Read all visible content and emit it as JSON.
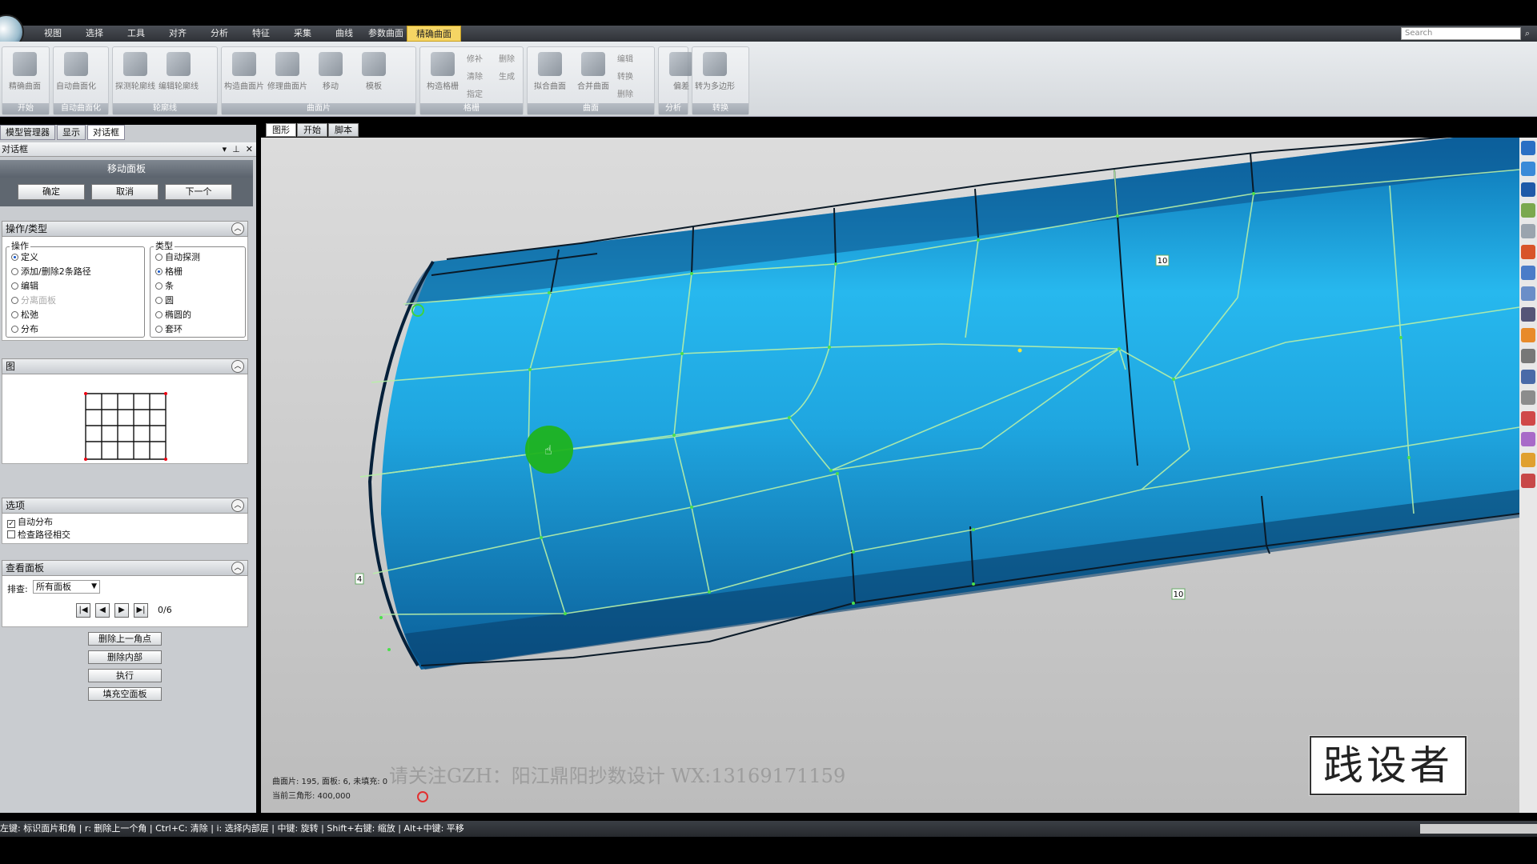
{
  "menu": {
    "items": [
      "视图",
      "选择",
      "工具",
      "对齐",
      "分析",
      "特征",
      "采集",
      "曲线",
      "参数曲面",
      "精确曲面"
    ],
    "active_index": 9,
    "search_placeholder": "Search"
  },
  "ribbon": {
    "groups": [
      {
        "title": "开始",
        "buttons": [
          "精确曲面"
        ]
      },
      {
        "title": "自动曲面化",
        "buttons": [
          "自动曲面化"
        ]
      },
      {
        "title": "轮廓线",
        "buttons": [
          "探测轮廓线",
          "编辑轮廓线"
        ]
      },
      {
        "title": "曲面片",
        "buttons": [
          "构造曲面片",
          "修理曲面片",
          "移动",
          "模板"
        ]
      },
      {
        "title": "格栅",
        "buttons": [
          "构造格栅"
        ],
        "small": [
          "修补",
          "清除",
          "指定",
          "删除",
          "生成"
        ]
      },
      {
        "title": "曲面",
        "buttons": [
          "拟合曲面",
          "合并曲面"
        ],
        "small": [
          "编辑",
          "转换",
          "删除"
        ]
      },
      {
        "title": "分析",
        "buttons": [
          "偏差"
        ]
      },
      {
        "title": "转换",
        "buttons": [
          "转为多边形"
        ]
      }
    ]
  },
  "left_panel": {
    "tabs": [
      "模型管理器",
      "显示",
      "对话框"
    ],
    "active_tab": 2,
    "dialog_header": "对话框",
    "dialog_title": "移动面板",
    "buttons": {
      "ok": "确定",
      "cancel": "取消",
      "next": "下一个"
    },
    "op_section": {
      "title": "操作/类型",
      "op_legend": "操作",
      "ops": [
        "定义",
        "添加/删除2条路径",
        "编辑",
        "分离面板",
        "松弛",
        "分布"
      ],
      "op_selected": 0,
      "type_legend": "类型",
      "types": [
        "自动探测",
        "格栅",
        "条",
        "圆",
        "椭圆的",
        "套环"
      ],
      "type_selected": 1
    },
    "graph_section": {
      "title": "图"
    },
    "options_section": {
      "title": "选项",
      "items": [
        {
          "label": "自动分布",
          "checked": true
        },
        {
          "label": "检查路径相交",
          "checked": false
        }
      ]
    },
    "view_section": {
      "title": "查看面板",
      "sort_label": "排查:",
      "sort_value": "所有面板",
      "counter": "0/6"
    },
    "actions": [
      "删除上一角点",
      "删除内部",
      "执行",
      "填充空面板"
    ]
  },
  "viewport": {
    "tabs": [
      "图形",
      "开始",
      "脚本"
    ],
    "active_tab": 0,
    "info_line1": "曲面片: 195, 面板: 6, 未填充: 0",
    "info_line2": "当前三角形: 400,000",
    "labels": [
      "10",
      "10",
      "4"
    ],
    "watermark": "请关注GZH：阳江鼎阳抄数设计 WX:13169171159",
    "brand": "践设者",
    "surface_color": "#1fa6e0",
    "cursor_color": "#1fb31f"
  },
  "statusbar": {
    "text": "左键: 标识面片和角 | r: 删除上一个角 | Ctrl+C: 清除 | i: 选择内部层 | 中键: 旋转 | Shift+右键: 缩放 | Alt+中键: 平移"
  }
}
